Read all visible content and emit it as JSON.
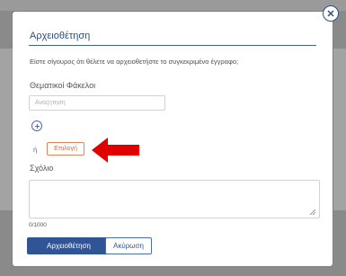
{
  "dialog": {
    "title": "Αρχειοθέτηση",
    "confirm_text": "Είστε σίγουρος ότι θέλετε να αρχειοθετήστε το συγκεκριμένο έγγραφο;",
    "folders_label": "Θεματικοί Φάκελοι",
    "search_placeholder": "Αναζήτηση",
    "or_text": "ή",
    "select_label": "Επιλογή",
    "comment_label": "Σχόλιο",
    "char_count": "0/1000",
    "archive_button": "Αρχειοθέτηση",
    "cancel_button": "Ακύρωση"
  },
  "icons": {
    "close": "close-circle-icon",
    "add": "plus-circle-icon",
    "arrow": "red-arrow-icon",
    "resize": "resize-grip-icon"
  },
  "colors": {
    "accent": "#2f5597",
    "select_accent": "#d8673f",
    "arrow": "#e00000",
    "backdrop": "#8a8a8a"
  }
}
